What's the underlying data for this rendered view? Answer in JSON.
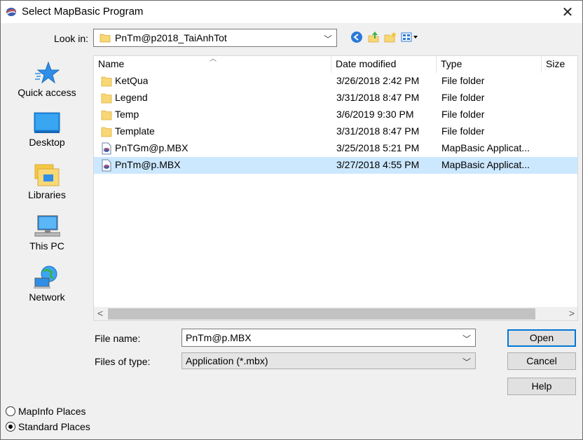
{
  "window": {
    "title": "Select MapBasic Program"
  },
  "toolbar": {
    "look_in_label": "Look in:",
    "look_in_value": "PnTm@p2018_TaiAnhTot"
  },
  "places": [
    {
      "label": "Quick access",
      "icon": "quick-access-star-icon"
    },
    {
      "label": "Desktop",
      "icon": "desktop-icon"
    },
    {
      "label": "Libraries",
      "icon": "libraries-icon"
    },
    {
      "label": "This PC",
      "icon": "computer-icon"
    },
    {
      "label": "Network",
      "icon": "network-icon"
    }
  ],
  "columns": {
    "name": "Name",
    "date": "Date modified",
    "type": "Type",
    "size": "Size"
  },
  "files": [
    {
      "name": "KetQua",
      "date": "3/26/2018 2:42 PM",
      "type": "File folder",
      "icon": "folder-icon"
    },
    {
      "name": "Legend",
      "date": "3/31/2018 8:47 PM",
      "type": "File folder",
      "icon": "folder-icon"
    },
    {
      "name": "Temp",
      "date": "3/6/2019 9:30 PM",
      "type": "File folder",
      "icon": "folder-icon"
    },
    {
      "name": "Template",
      "date": "3/31/2018 8:47 PM",
      "type": "File folder",
      "icon": "folder-icon"
    },
    {
      "name": "PnTGm@p.MBX",
      "date": "3/25/2018 5:21 PM",
      "type": "MapBasic Applicat...",
      "icon": "mbx-file-icon"
    },
    {
      "name": "PnTm@p.MBX",
      "date": "3/27/2018 4:55 PM",
      "type": "MapBasic Applicat...",
      "icon": "mbx-file-icon",
      "selected": true
    }
  ],
  "form": {
    "file_name_label": "File name:",
    "file_name_value": "PnTm@p.MBX",
    "file_type_label": "Files of type:",
    "file_type_value": "Application (*.mbx)"
  },
  "buttons": {
    "open": "Open",
    "cancel": "Cancel",
    "help": "Help"
  },
  "radios": {
    "mapinfo_places": "MapInfo Places",
    "standard_places": "Standard Places",
    "selected": "standard_places"
  },
  "colors": {
    "selection": "#cce8ff",
    "accent": "#0078d7",
    "folder": "#f8d775"
  }
}
